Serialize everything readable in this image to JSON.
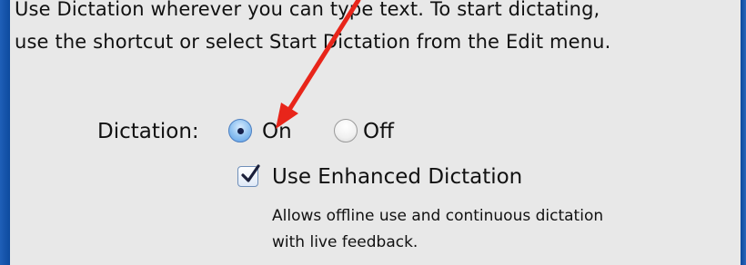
{
  "description_lines": [
    "Use Dictation wherever you can type text. To start dictating,",
    "use the shortcut or select Start Dictation from the Edit menu."
  ],
  "dictation": {
    "label": "Dictation:",
    "options": [
      {
        "label": "On",
        "selected": true
      },
      {
        "label": "Off",
        "selected": false
      }
    ]
  },
  "enhanced": {
    "label": "Use Enhanced Dictation",
    "checked": true,
    "help_lines": [
      "Allows offline use and continuous dictation",
      "with live feedback."
    ]
  },
  "colors": {
    "annotation_arrow": "#e8251a",
    "background": "#0d4a9e",
    "panel": "#e8e8e8"
  },
  "icons": {
    "annotation": "arrow-icon",
    "checkbox": "checkmark-icon"
  }
}
